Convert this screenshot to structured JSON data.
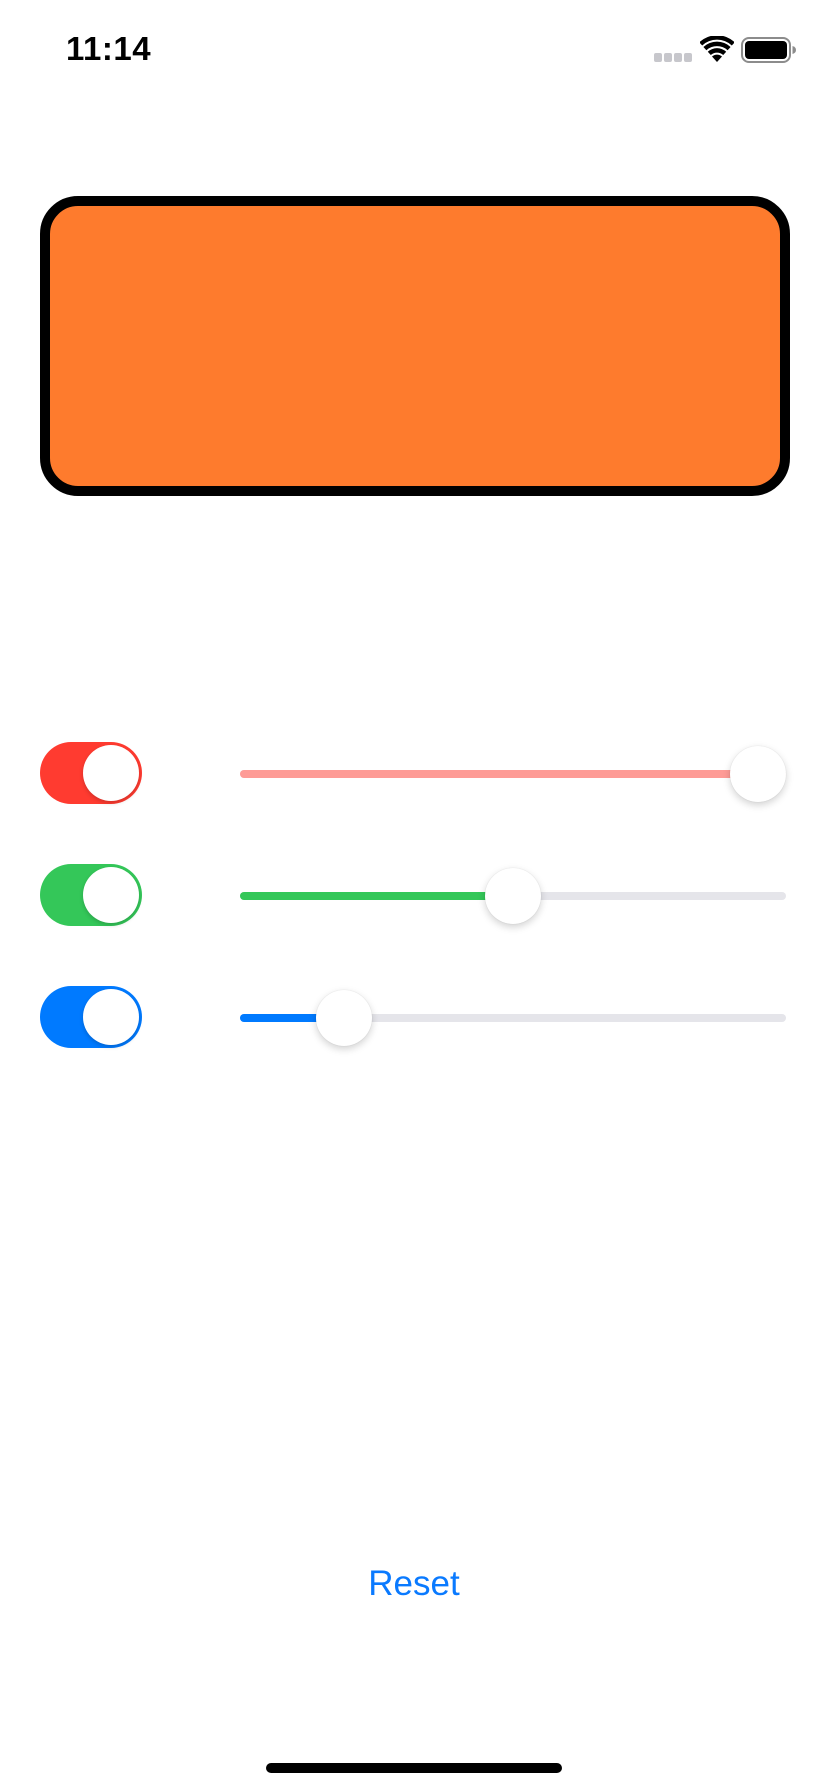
{
  "status_bar": {
    "time": "11:14",
    "icons": [
      "cellular-signal-icon",
      "wifi-icon",
      "battery-icon"
    ]
  },
  "preview": {
    "color": "#fe7b2d",
    "border_color": "#000000"
  },
  "controls": [
    {
      "channel": "red",
      "toggle_on": true,
      "toggle_color": "#ff3b30",
      "slider_fill_color": "#fe9b96",
      "slider_value": 1.0
    },
    {
      "channel": "green",
      "toggle_on": true,
      "toggle_color": "#34c759",
      "slider_fill_color": "#34c759",
      "slider_value": 0.5
    },
    {
      "channel": "blue",
      "toggle_on": true,
      "toggle_color": "#007aff",
      "slider_fill_color": "#007aff",
      "slider_value": 0.19
    }
  ],
  "reset": {
    "label": "Reset",
    "color": "#0a7aff"
  }
}
